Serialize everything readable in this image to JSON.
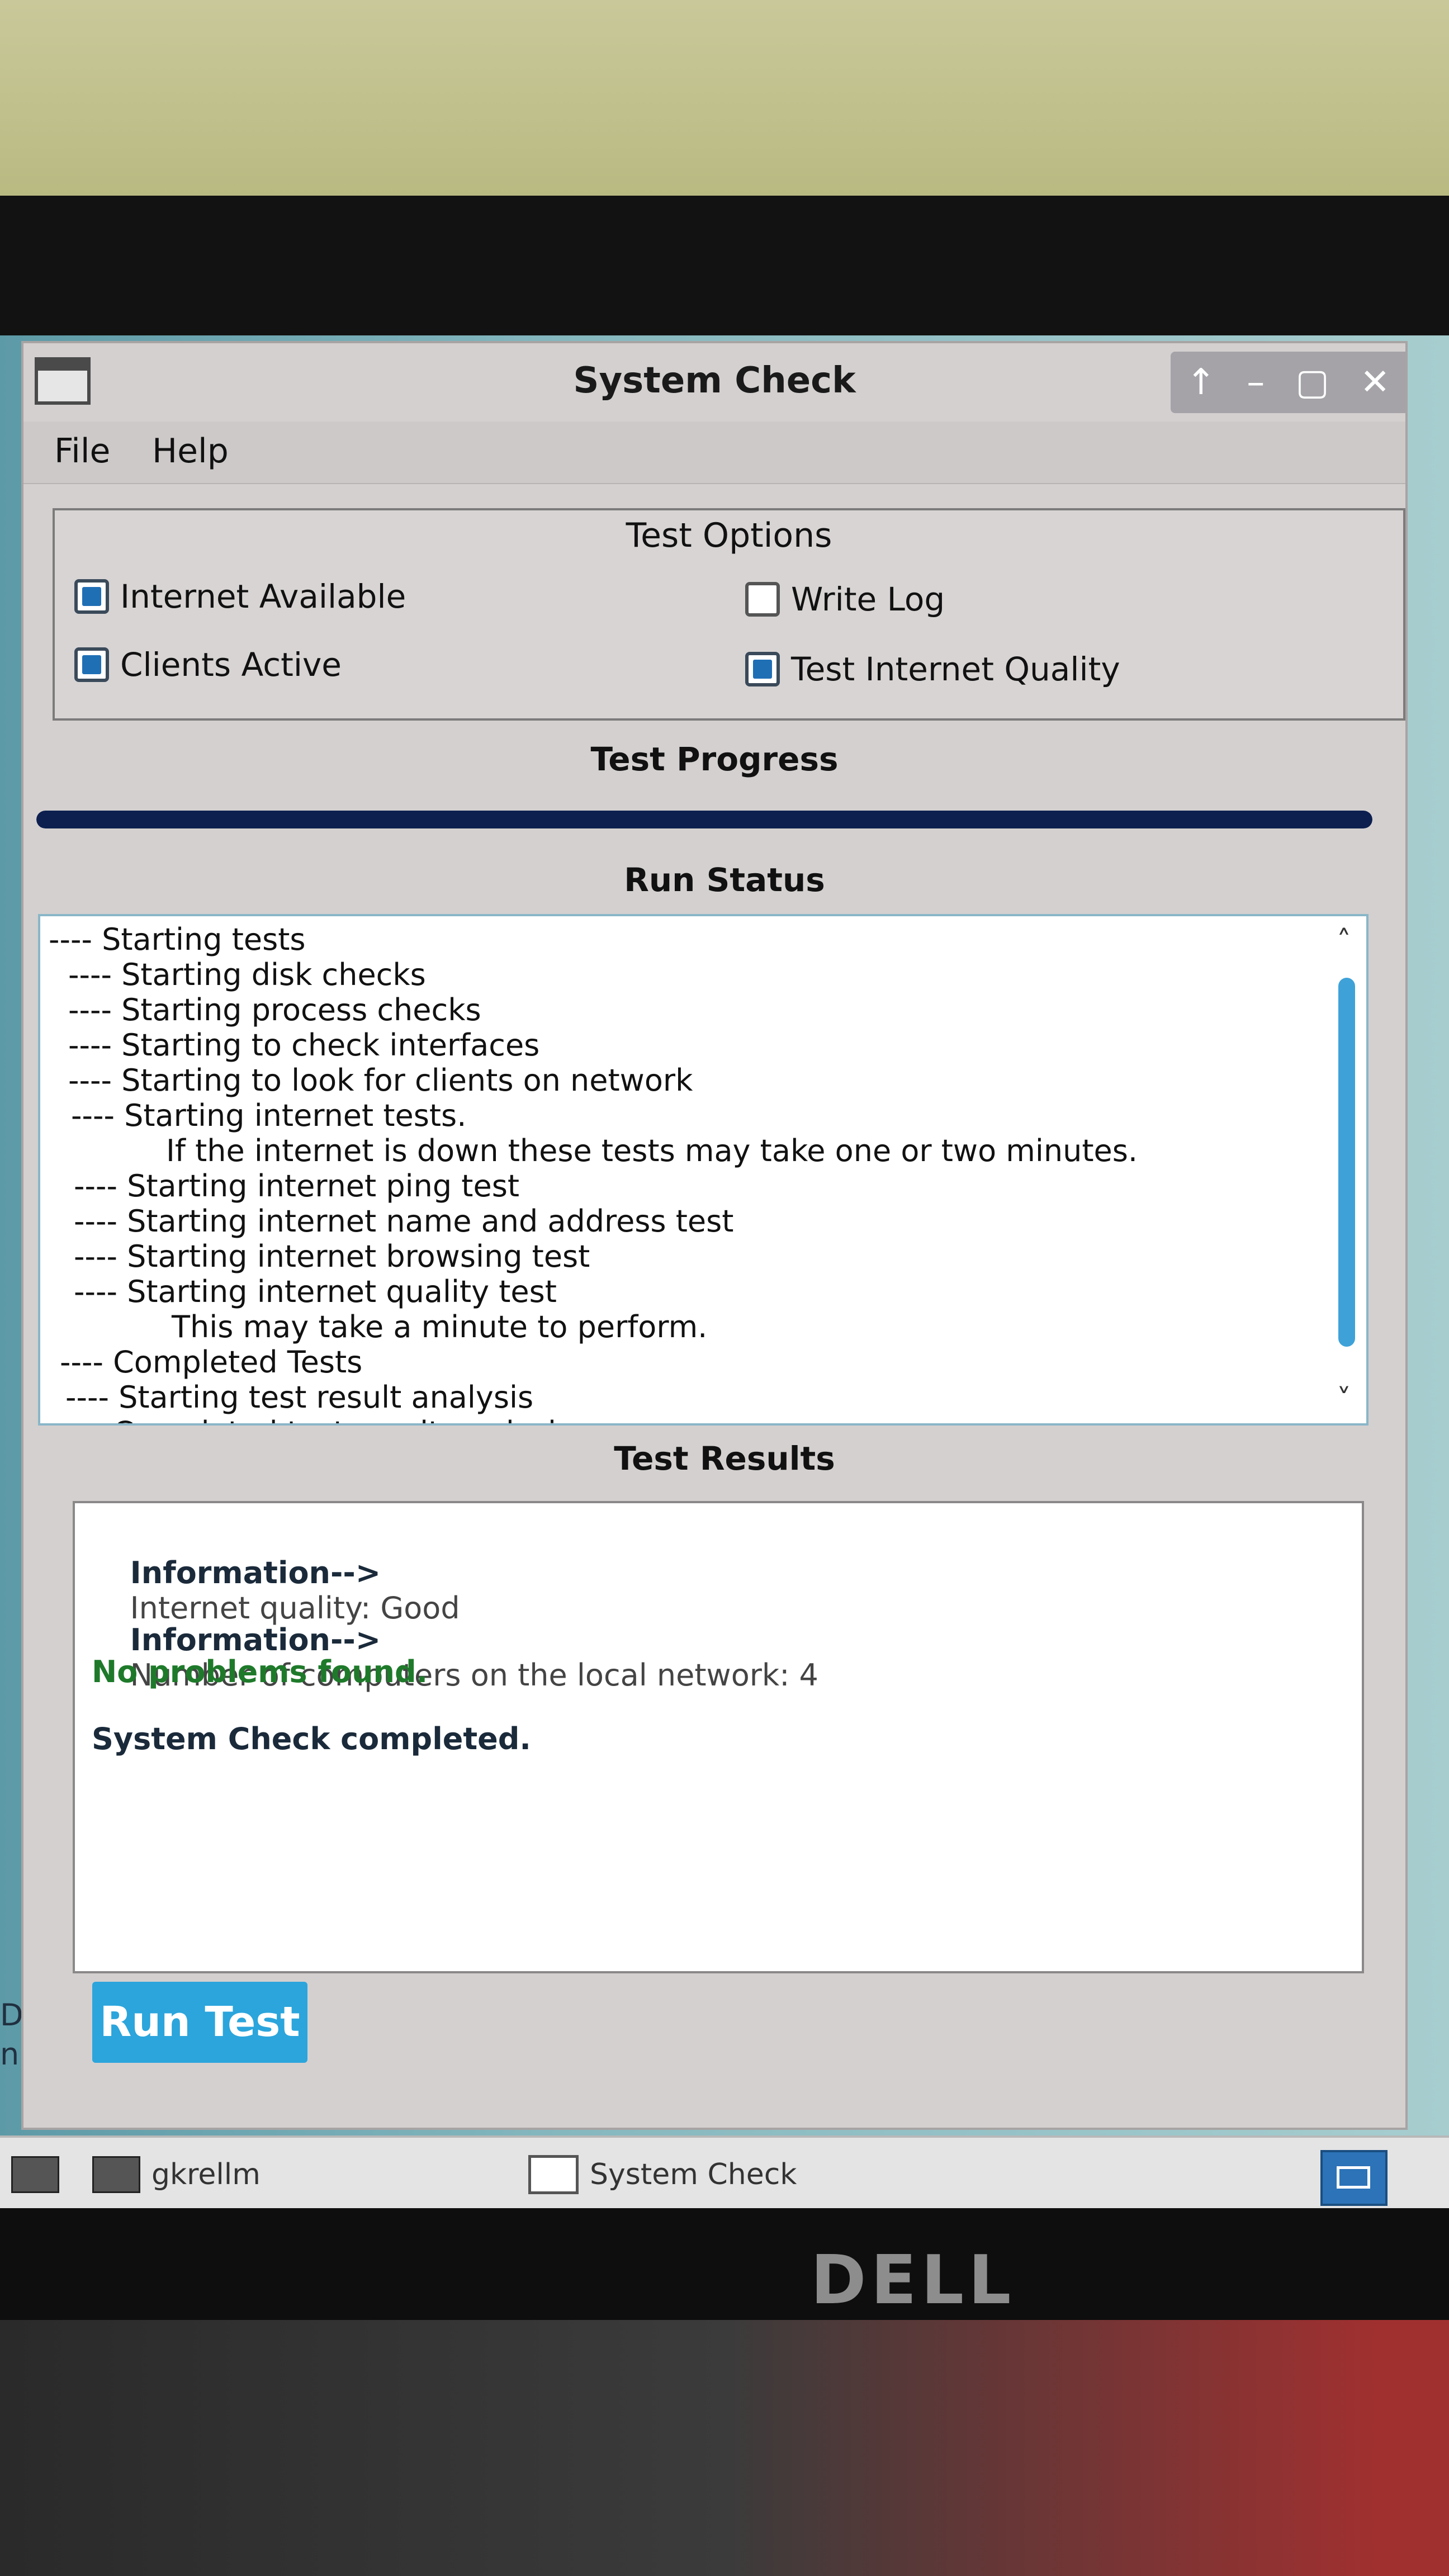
{
  "window": {
    "title": "System Check",
    "controls": [
      "↑",
      "–",
      "▢",
      "✕"
    ]
  },
  "menu": {
    "file": "File",
    "help": "Help"
  },
  "test_options": {
    "title": "Test Options",
    "items": [
      {
        "label": "Internet Available",
        "checked": true
      },
      {
        "label": "Clients Active",
        "checked": true
      },
      {
        "label": "Write Log",
        "checked": false
      },
      {
        "label": "Test Internet Quality",
        "checked": true
      }
    ]
  },
  "progress": {
    "label": "Test Progress",
    "fraction": 1.0
  },
  "run_status": {
    "label": "Run Status",
    "lines": [
      "---- Starting tests",
      "---- Starting disk checks",
      "---- Starting process checks",
      "---- Starting to check interfaces",
      "---- Starting to look for clients on network",
      "---- Starting internet tests.",
      "If the internet is down these tests may take one or two minutes.",
      "---- Starting internet ping test",
      "---- Starting internet name and address test",
      "---- Starting internet browsing test",
      "---- Starting internet quality test",
      "This may take a minute to perform.",
      "---- Completed Tests",
      "---- Starting test result analysis",
      "Completed test result analysis"
    ]
  },
  "test_results": {
    "label": "Test Results",
    "info_tag": "Information-->",
    "info_1": "Internet quality: Good",
    "info_2": "Number of computers on the local network: 4",
    "ok": "No problems found.",
    "done": "System Check completed."
  },
  "run_button": "Run Test",
  "desktop_icon_text": [
    "D Sys",
    "nual..."
  ],
  "taskbar": {
    "item1": "gkrellm",
    "item2": "System Check"
  },
  "monitor_brand": "DELL",
  "colors": {
    "accent": "#2ba5dc",
    "progress": "#0d1f4f",
    "ok": "#1e7a2a"
  }
}
